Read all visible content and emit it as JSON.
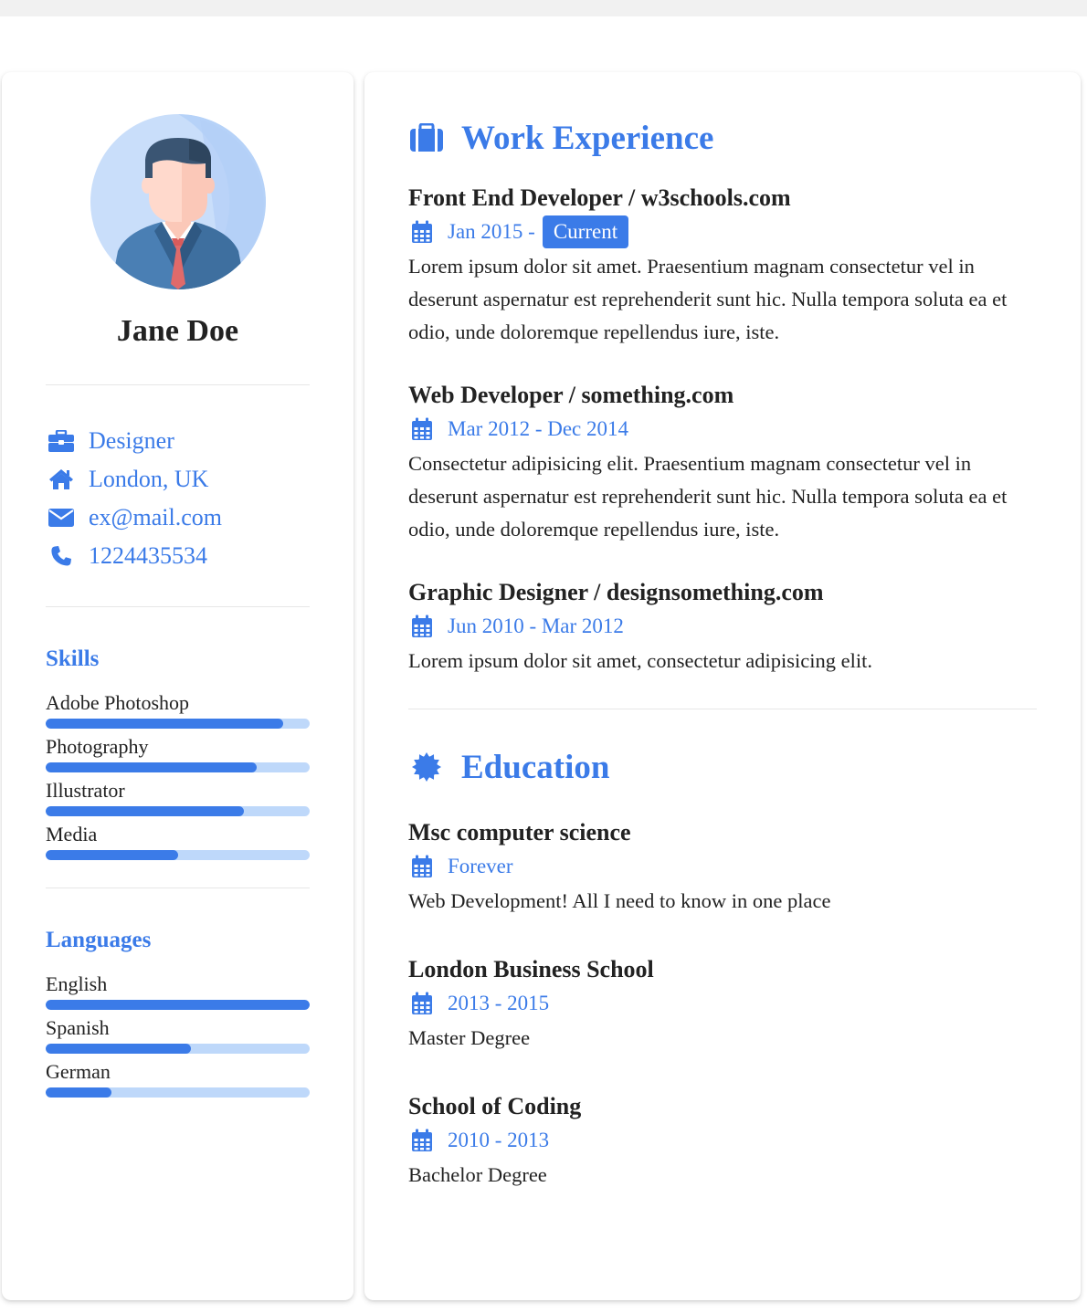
{
  "colors": {
    "accent": "#3b7be8",
    "track": "#bed8fa",
    "text": "#222222"
  },
  "profile": {
    "name": "Jane Doe",
    "avatar_icon": "businessman-avatar"
  },
  "contacts": [
    {
      "icon": "briefcase-icon",
      "text": "Designer"
    },
    {
      "icon": "home-icon",
      "text": "London, UK"
    },
    {
      "icon": "envelope-icon",
      "text": "ex@mail.com"
    },
    {
      "icon": "phone-icon",
      "text": "1224435534"
    }
  ],
  "skills": {
    "title": "Skills",
    "items": [
      {
        "label": "Adobe Photoshop",
        "level": 0.9
      },
      {
        "label": "Photography",
        "level": 0.8
      },
      {
        "label": "Illustrator",
        "level": 0.75
      },
      {
        "label": "Media",
        "level": 0.5
      }
    ]
  },
  "languages": {
    "title": "Languages",
    "items": [
      {
        "label": "English",
        "level": 1.0
      },
      {
        "label": "Spanish",
        "level": 0.55
      },
      {
        "label": "German",
        "level": 0.25
      }
    ]
  },
  "work": {
    "title": "Work Experience",
    "icon": "suitcase-icon",
    "entries": [
      {
        "title": "Front End Developer / w3schools.com",
        "date": "Jan 2015 -",
        "badge": "Current",
        "desc": "Lorem ipsum dolor sit amet. Praesentium magnam consectetur vel in deserunt aspernatur est reprehenderit sunt hic. Nulla tempora soluta ea et odio, unde doloremque repellendus iure, iste."
      },
      {
        "title": "Web Developer / something.com",
        "date": "Mar 2012 - Dec 2014",
        "desc": "Consectetur adipisicing elit. Praesentium magnam consectetur vel in deserunt aspernatur est reprehenderit sunt hic. Nulla tempora soluta ea et odio, unde doloremque repellendus iure, iste."
      },
      {
        "title": "Graphic Designer / designsomething.com",
        "date": "Jun 2010 - Mar 2012",
        "desc": "Lorem ipsum dolor sit amet, consectetur adipisicing elit."
      }
    ]
  },
  "education": {
    "title": "Education",
    "icon": "certificate-icon",
    "entries": [
      {
        "title": "Msc computer science",
        "date": "Forever",
        "desc": "Web Development! All I need to know in one place"
      },
      {
        "title": "London Business School",
        "date": "2013 - 2015",
        "desc": "Master Degree"
      },
      {
        "title": "School of Coding",
        "date": "2010 - 2013",
        "desc": "Bachelor Degree"
      }
    ]
  }
}
